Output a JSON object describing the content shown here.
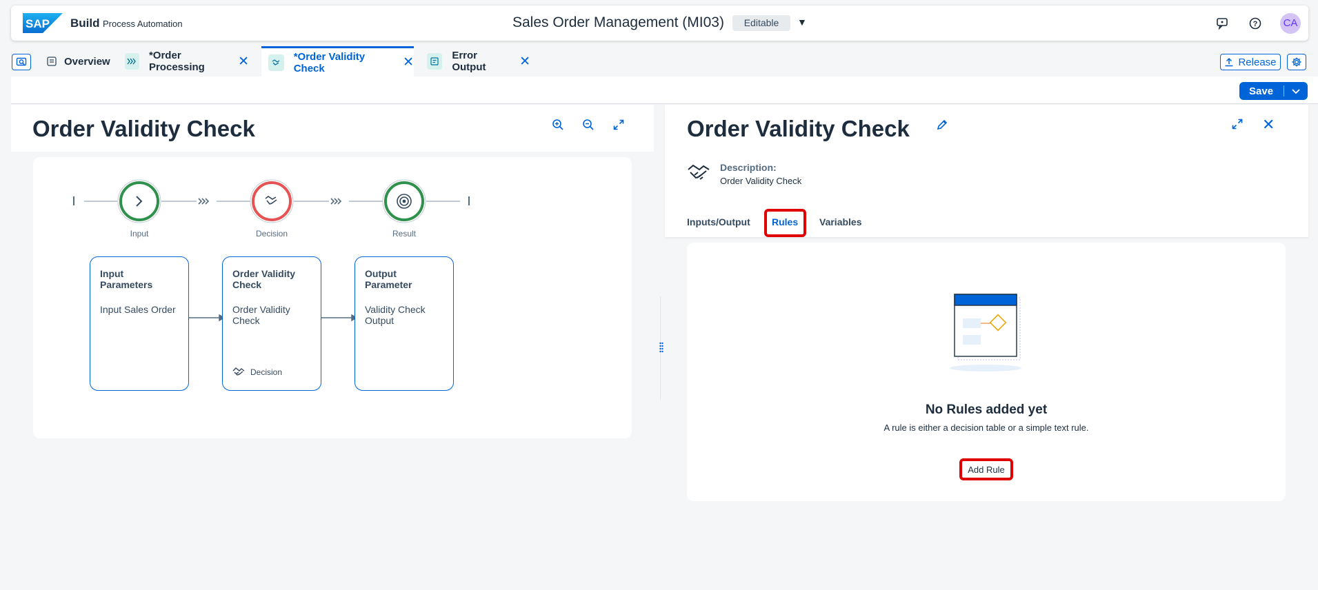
{
  "shell": {
    "brand": "Build",
    "brand_sub": "Process Automation",
    "app_title": "Sales Order Management (MI03)",
    "mode_badge": "Editable",
    "avatar_initials": "CA"
  },
  "tabs": [
    {
      "label": "Overview",
      "icon": "overview-icon",
      "closable": false
    },
    {
      "label": "*Order Processing",
      "icon": "process-icon",
      "closable": true
    },
    {
      "label": "*Order Validity Check",
      "icon": "decision-icon",
      "closable": true,
      "active": true
    },
    {
      "label": "Error Output",
      "icon": "form-icon",
      "closable": true
    }
  ],
  "actions": {
    "release_label": "Release",
    "save_label": "Save"
  },
  "left_panel": {
    "title": "Order Validity Check",
    "steps": [
      {
        "label": "Input",
        "status_color": "#30914c",
        "icon": "chevron-right-icon"
      },
      {
        "label": "Decision",
        "status_color": "#e55353",
        "icon": "handshake-icon"
      },
      {
        "label": "Result",
        "status_color": "#30914c",
        "icon": "target-icon"
      }
    ],
    "nodes": [
      {
        "title": "Input Parameters",
        "text": "Input Sales Order",
        "footer": ""
      },
      {
        "title": "Order Validity Check",
        "text": "Order Validity Check",
        "footer": "Decision"
      },
      {
        "title": "Output Parameter",
        "text": "Validity Check Output",
        "footer": ""
      }
    ]
  },
  "right_panel": {
    "title": "Order Validity Check",
    "description_label": "Description:",
    "description_value": "Order Validity Check",
    "tabs": [
      "Inputs/Output",
      "Rules",
      "Variables"
    ],
    "active_tab": "Rules",
    "empty_title": "No Rules added yet",
    "empty_subtitle": "A rule is either a decision table or a simple text rule.",
    "add_rule_label": "Add Rule"
  },
  "colors": {
    "accent": "#0064d9",
    "highlight": "#e10000"
  }
}
